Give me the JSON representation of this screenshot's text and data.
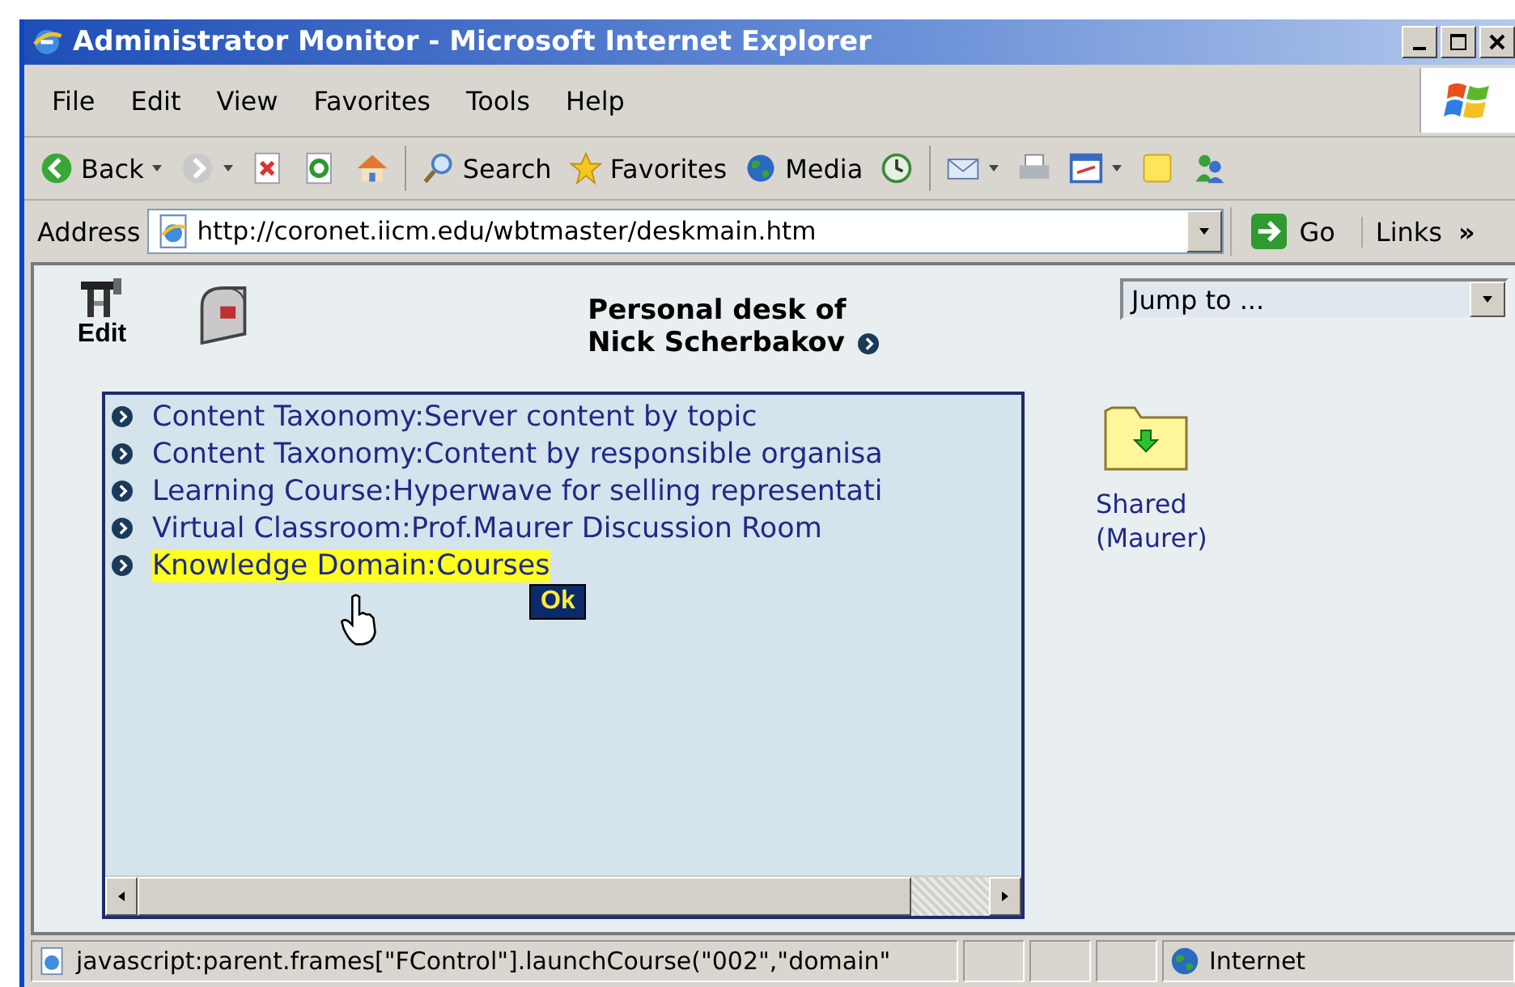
{
  "window": {
    "title": "Administrator Monitor - Microsoft Internet Explorer"
  },
  "menu": [
    "File",
    "Edit",
    "View",
    "Favorites",
    "Tools",
    "Help"
  ],
  "toolbar": [
    {
      "kind": "back",
      "label": "Back",
      "dropdown": true
    },
    {
      "kind": "forward",
      "dropdown": true
    },
    {
      "kind": "stop"
    },
    {
      "kind": "refresh"
    },
    {
      "kind": "home"
    },
    {
      "kind": "separator"
    },
    {
      "kind": "search",
      "label": "Search"
    },
    {
      "kind": "favorites",
      "label": "Favorites"
    },
    {
      "kind": "media",
      "label": "Media"
    },
    {
      "kind": "history"
    },
    {
      "kind": "separator"
    },
    {
      "kind": "mail",
      "dropdown": true
    },
    {
      "kind": "print"
    },
    {
      "kind": "edit",
      "dropdown": true
    },
    {
      "kind": "note"
    },
    {
      "kind": "messenger"
    }
  ],
  "address": {
    "label": "Address",
    "url": "http://coronet.iicm.edu/wbtmaster/deskmain.htm",
    "go": "Go",
    "links": "Links",
    "more": "»"
  },
  "page": {
    "edit_label": "Edit",
    "title_lines": [
      "Personal desk of",
      "Nick Scherbakov"
    ],
    "jump_to": "Jump to ...",
    "list": [
      {
        "text": "Content Taxonomy:Server content by topic",
        "selected": false
      },
      {
        "text": "Content Taxonomy:Content by responsible organisa",
        "selected": false
      },
      {
        "text": "Learning Course:Hyperwave for selling representati",
        "selected": false
      },
      {
        "text": "Virtual Classroom:Prof.Maurer Discussion Room",
        "selected": false
      },
      {
        "text": "Knowledge Domain:Courses",
        "selected": true
      }
    ],
    "ok": "Ok",
    "folder": {
      "label_lines": [
        "Shared",
        "(Maurer)"
      ]
    }
  },
  "status_bar": {
    "text": "javascript:parent.frames[\"FControl\"].launchCourse(\"002\",\"domain\"",
    "zone": "Internet"
  }
}
